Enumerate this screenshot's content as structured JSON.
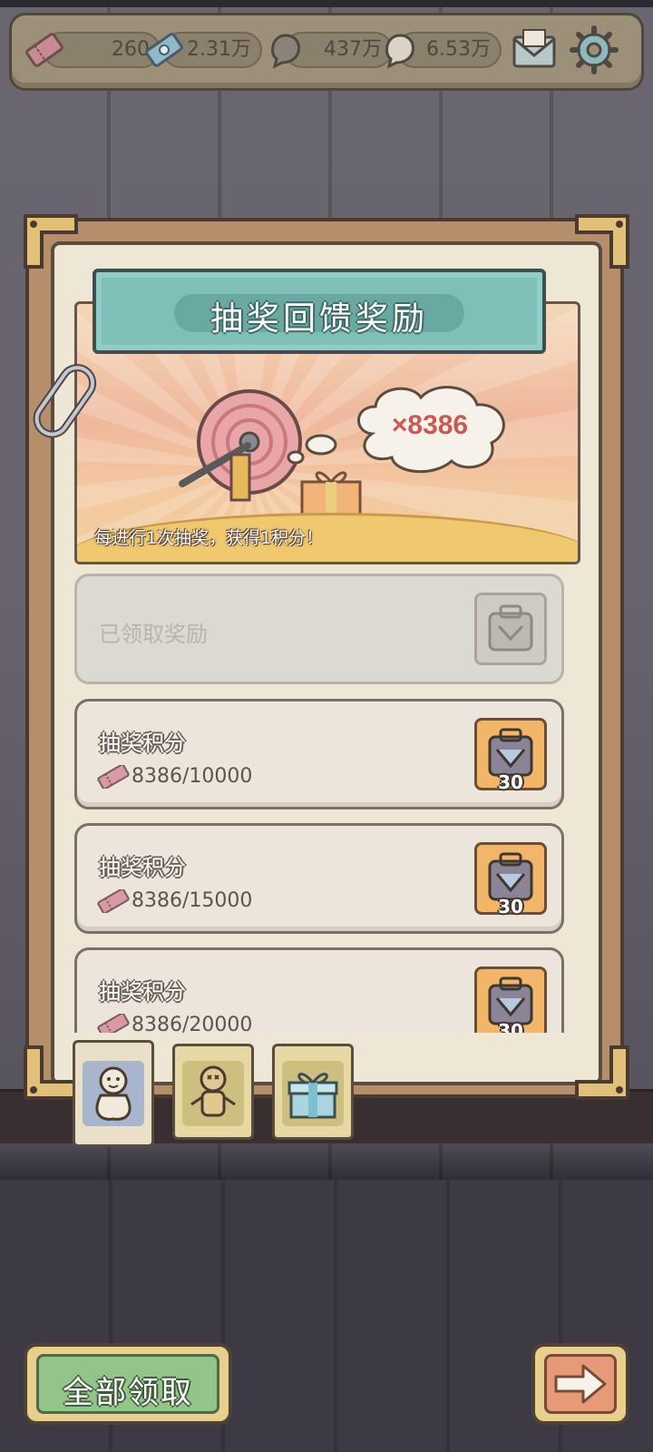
{
  "currencies": [
    {
      "icon": "ticket-icon",
      "value": "260"
    },
    {
      "icon": "crystal-ticket-icon",
      "value": "2.31万"
    },
    {
      "icon": "soul-icon",
      "value": "437万"
    },
    {
      "icon": "ghost-icon",
      "value": "6.53万"
    }
  ],
  "top_buttons": {
    "mail": "mail-icon",
    "settings": "gear-icon"
  },
  "panel": {
    "title": "抽奖回馈奖励",
    "points_display": "×8386",
    "note": "每进行1次抽奖，获得1积分！"
  },
  "rewards": [
    {
      "title": "已领取奖励",
      "claimed": true,
      "progress": "",
      "count": ""
    },
    {
      "title": "抽奖积分",
      "claimed": false,
      "progress": "8386/10000",
      "count": "30"
    },
    {
      "title": "抽奖积分",
      "claimed": false,
      "progress": "8386/15000",
      "count": "30"
    },
    {
      "title": "抽奖积分",
      "claimed": false,
      "progress": "8386/20000",
      "count": "30"
    }
  ],
  "tabs": [
    {
      "icon": "voodoo-doll-icon",
      "active": true
    },
    {
      "icon": "stitched-doll-icon",
      "active": false
    },
    {
      "icon": "gift-box-icon",
      "active": false
    }
  ],
  "buttons": {
    "claim_all": "全部领取",
    "next": "arrow-right-icon"
  },
  "colors": {
    "accent_teal": "#7fbfb8",
    "claim_green": "#93c48a",
    "points_red": "#c75a52",
    "reward_orange": "#f2b66a"
  }
}
